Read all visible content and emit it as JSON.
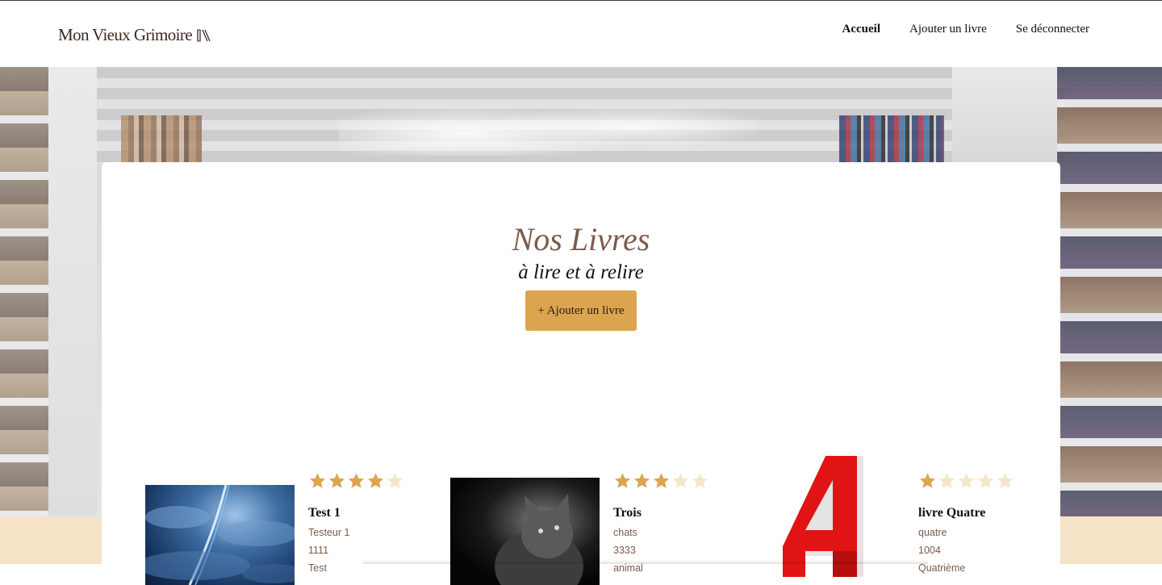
{
  "header": {
    "logo_text": "Mon Vieux Grimoire",
    "nav": [
      {
        "label": "Accueil",
        "active": true
      },
      {
        "label": "Ajouter un livre",
        "active": false
      },
      {
        "label": "Se déconnecter",
        "active": false
      }
    ]
  },
  "main": {
    "title": "Nos Livres",
    "subtitle": "à lire et à relire",
    "add_button": "+ Ajouter un livre"
  },
  "books": [
    {
      "title": "Test 1",
      "author": "Testeur 1",
      "year": "1111",
      "genre": "Test",
      "rating": 4,
      "cover": "comet-sky"
    },
    {
      "title": "Trois",
      "author": "chats",
      "year": "3333",
      "genre": "animal",
      "rating": 3,
      "cover": "cat"
    },
    {
      "title": "livre Quatre",
      "author": "quatre",
      "year": "1004",
      "genre": "Quatrième",
      "rating": 1,
      "cover": "red-number-4"
    }
  ],
  "colors": {
    "accent": "#dba550",
    "brown": "#7b5b4c",
    "star_filled": "#dba550",
    "star_empty": "#f5e6c8",
    "cream": "#f4e3c6"
  },
  "icons": {
    "logo": "books-icon",
    "rating": "star-icon"
  }
}
